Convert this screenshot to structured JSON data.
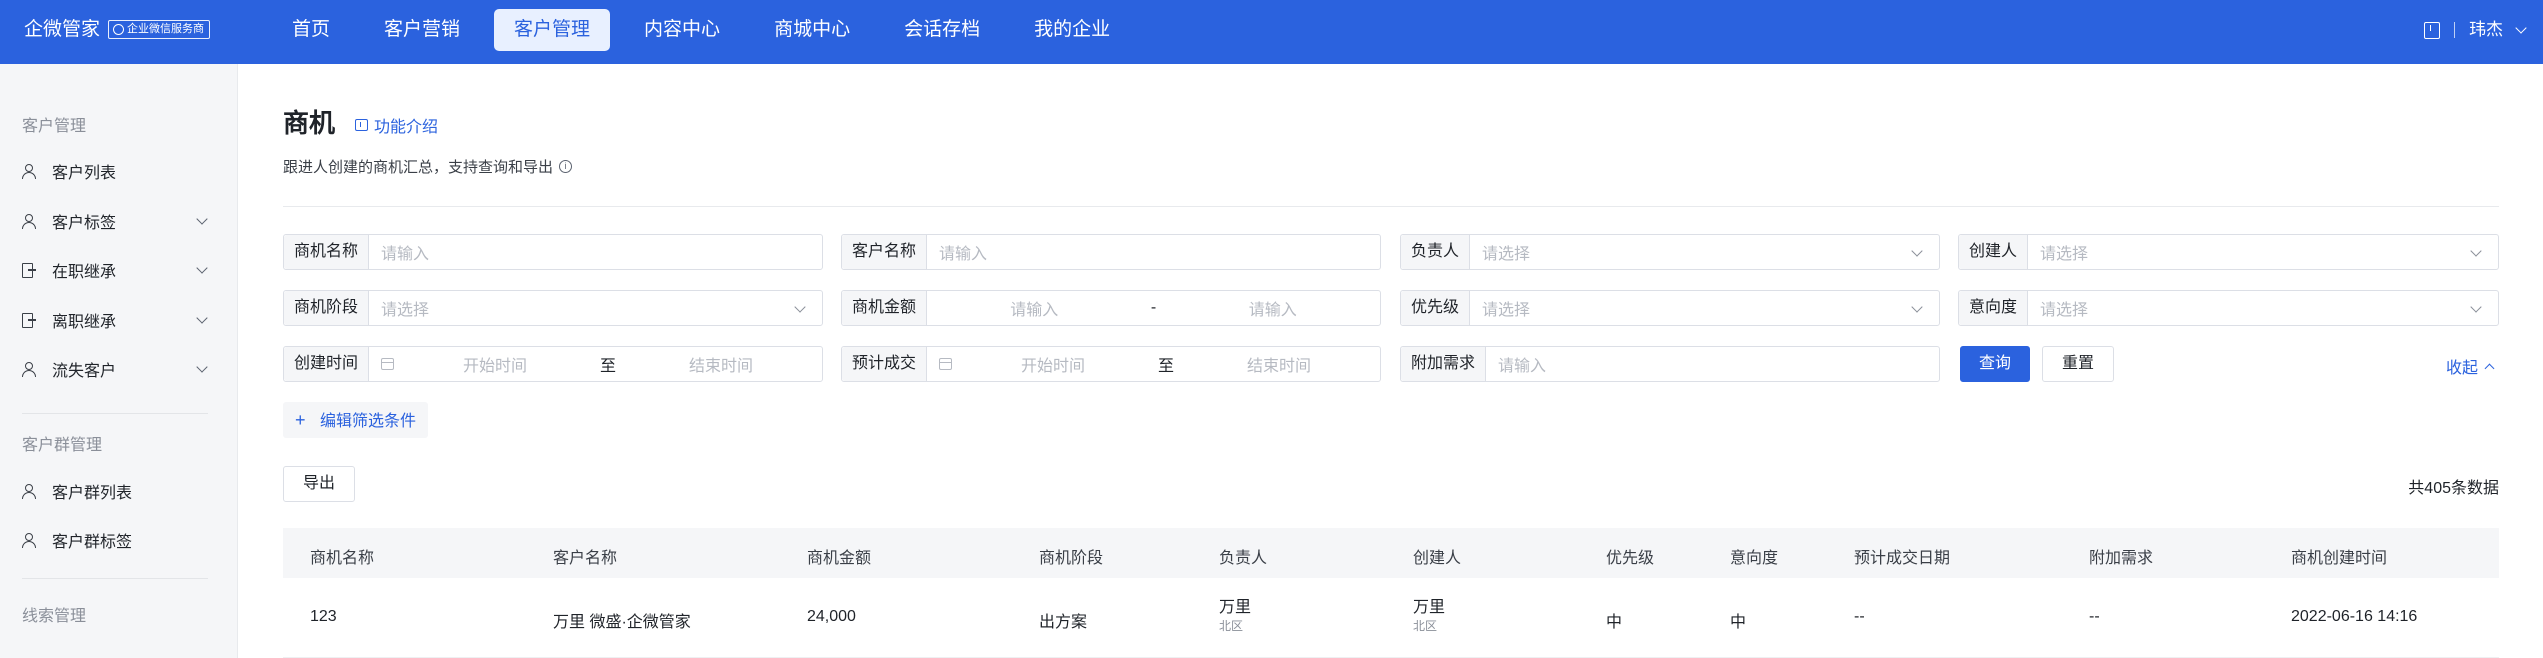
{
  "app": {
    "brand": "企微管家",
    "badge": "企业微信服务商"
  },
  "nav": [
    "首页",
    "客户营销",
    "客户管理",
    "内容中心",
    "商城中心",
    "会话存档",
    "我的企业"
  ],
  "nav_active": "客户管理",
  "user": {
    "name": "玮杰"
  },
  "sidebar": {
    "groups": [
      {
        "title": "客户管理",
        "items": [
          {
            "label": "客户列表",
            "icon": "user-icon",
            "has_children": false
          },
          {
            "label": "客户标签",
            "icon": "user-icon",
            "has_children": true
          },
          {
            "label": "在职继承",
            "icon": "door-icon",
            "has_children": true
          },
          {
            "label": "离职继承",
            "icon": "door-icon",
            "has_children": true
          },
          {
            "label": "流失客户",
            "icon": "user-icon",
            "has_children": true
          }
        ]
      },
      {
        "title": "客户群管理",
        "items": [
          {
            "label": "客户群列表",
            "icon": "user-icon",
            "has_children": false
          },
          {
            "label": "客户群标签",
            "icon": "user-icon",
            "has_children": false
          }
        ]
      },
      {
        "title": "线索管理",
        "items": []
      }
    ]
  },
  "page": {
    "title": "商机",
    "intro_link": "功能介绍",
    "subtitle": "跟进人创建的商机汇总，支持查询和导出"
  },
  "filters": {
    "opp_name": {
      "label": "商机名称",
      "placeholder": "请输入"
    },
    "customer_name": {
      "label": "客户名称",
      "placeholder": "请输入"
    },
    "owner": {
      "label": "负责人",
      "placeholder": "请选择"
    },
    "creator": {
      "label": "创建人",
      "placeholder": "请选择"
    },
    "stage": {
      "label": "商机阶段",
      "placeholder": "请选择"
    },
    "amount": {
      "label": "商机金额",
      "from_placeholder": "请输入",
      "separator": "-",
      "to_placeholder": "请输入"
    },
    "priority": {
      "label": "优先级",
      "placeholder": "请选择"
    },
    "intention": {
      "label": "意向度",
      "placeholder": "请选择"
    },
    "created_time": {
      "label": "创建时间",
      "start_placeholder": "开始时间",
      "separator": "至",
      "end_placeholder": "结束时间"
    },
    "expected_deal": {
      "label": "预计成交",
      "start_placeholder": "开始时间",
      "separator": "至",
      "end_placeholder": "结束时间"
    },
    "extra_needs": {
      "label": "附加需求",
      "placeholder": "请输入"
    },
    "query_button": "查询",
    "reset_button": "重置",
    "collapse_link": "收起",
    "edit_filter_button": "编辑筛选条件"
  },
  "export_button": "导出",
  "total_text": "共405条数据",
  "table": {
    "columns": [
      "商机名称",
      "客户名称",
      "商机金额",
      "商机阶段",
      "负责人",
      "创建人",
      "优先级",
      "意向度",
      "预计成交日期",
      "附加需求",
      "商机创建时间"
    ],
    "rows": [
      {
        "name": "123",
        "customer": "万里 微盛·企微管家",
        "amount": "24,000",
        "stage": "出方案",
        "owner": "万里",
        "owner_dept": "北区",
        "creator": "万里",
        "creator_dept": "北区",
        "priority": "中",
        "intention": "中",
        "expected_date": "--",
        "extra_needs": "--",
        "created_at": "2022-06-16 14:16"
      }
    ]
  },
  "colors": {
    "primary": "#2b62de",
    "sidebar_bg": "#f5f6f8"
  }
}
